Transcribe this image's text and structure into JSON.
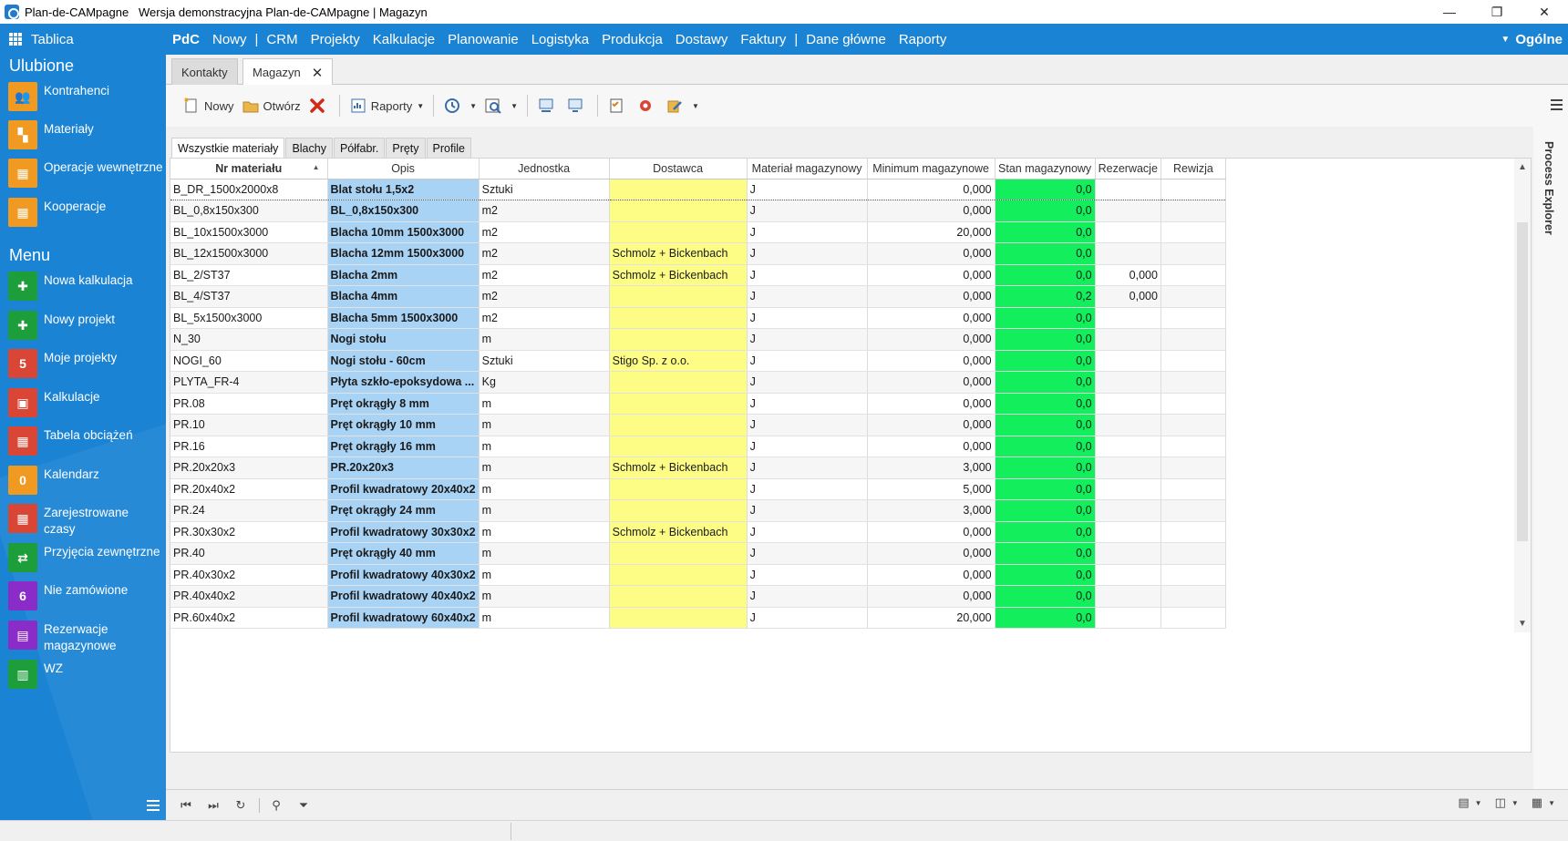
{
  "window": {
    "title": "Plan-de-CAMpagne   Wersja demonstracyjna Plan-de-CAMpagne | Magazyn",
    "minimize": "—",
    "restore": "❐",
    "close": "✕"
  },
  "menubar": {
    "home": "Tablica",
    "items": [
      "PdC",
      "Nowy",
      "|",
      "CRM",
      "Projekty",
      "Kalkulacje",
      "Planowanie",
      "Logistyka",
      "Produkcja",
      "Dostawy",
      "Faktury",
      "|",
      "Dane główne",
      "Raporty"
    ],
    "right": "Ogólne"
  },
  "sidebar": {
    "favorites_heading": "Ulubione",
    "favorites": [
      {
        "label": "Kontrahenci",
        "icon": "people-icon",
        "color": "#f09a22"
      },
      {
        "label": "Materiały",
        "icon": "materials-icon",
        "color": "#f09a22"
      },
      {
        "label": "Operacje wewnętrzne",
        "icon": "table-icon",
        "color": "#f09a22"
      },
      {
        "label": "Kooperacje",
        "icon": "table-icon",
        "color": "#f09a22"
      }
    ],
    "menu_heading": "Menu",
    "menu": [
      {
        "label": "Nowa kalkulacja",
        "icon": "new-document-icon",
        "color": "#1e9e3a",
        "badge": ""
      },
      {
        "label": "Nowy projekt",
        "icon": "new-document-icon",
        "color": "#1e9e3a",
        "badge": ""
      },
      {
        "label": "Moje projekty",
        "icon": "count-badge",
        "color": "#d94636",
        "badge": "5"
      },
      {
        "label": "Kalkulacje",
        "icon": "calculator-icon",
        "color": "#d94636",
        "badge": ""
      },
      {
        "label": "Tabela obciążeń",
        "icon": "table-icon",
        "color": "#d94636",
        "badge": ""
      },
      {
        "label": "Kalendarz",
        "icon": "count-badge",
        "color": "#f09a22",
        "badge": "0"
      },
      {
        "label": "Zarejestrowane czasy",
        "icon": "table-icon",
        "color": "#d94636",
        "badge": ""
      },
      {
        "label": "Przyjęcia zewnętrzne",
        "icon": "receipt-icon",
        "color": "#1e9e3a",
        "badge": ""
      },
      {
        "label": "Nie zamówione",
        "icon": "count-badge",
        "color": "#8a2cc8",
        "badge": "6"
      },
      {
        "label": "Rezerwacje magazynowe",
        "icon": "reservation-icon",
        "color": "#8a2cc8",
        "badge": ""
      },
      {
        "label": "WZ",
        "icon": "document-icon",
        "color": "#1e9e3a",
        "badge": ""
      }
    ]
  },
  "doctabs": {
    "tabs": [
      {
        "label": "Kontakty",
        "active": false
      },
      {
        "label": "Magazyn",
        "active": true
      }
    ],
    "close": "✕"
  },
  "toolbar": {
    "new_label": "Nowy",
    "open_label": "Otwórz",
    "reports_label": "Raporty"
  },
  "filter_tabs": [
    "Wszystkie materiały",
    "Blachy",
    "Półfabr.",
    "Pręty",
    "Profile"
  ],
  "grid": {
    "columns": [
      "Nr materiału",
      "Opis",
      "Jednostka",
      "Dostawca",
      "Materiał magazynowy",
      "Minimum magazynowe",
      "Stan magazynowy",
      "Rezerwacje",
      "Rewizja"
    ],
    "rows": [
      [
        "B_DR_1500x2000x8",
        "Blat stołu 1,5x2",
        "Sztuki",
        "",
        "J",
        "0,000",
        "0,0",
        "",
        ""
      ],
      [
        "BL_0,8x150x300",
        "BL_0,8x150x300",
        "m2",
        "",
        "J",
        "0,000",
        "0,0",
        "",
        ""
      ],
      [
        "BL_10x1500x3000",
        "Blacha 10mm 1500x3000",
        "m2",
        "",
        "J",
        "20,000",
        "0,0",
        "",
        ""
      ],
      [
        "BL_12x1500x3000",
        "Blacha 12mm 1500x3000",
        "m2",
        "Schmolz + Bickenbach",
        "J",
        "0,000",
        "0,0",
        "",
        ""
      ],
      [
        "BL_2/ST37",
        "Blacha 2mm",
        "m2",
        "Schmolz + Bickenbach",
        "J",
        "0,000",
        "0,0",
        "0,000",
        ""
      ],
      [
        "BL_4/ST37",
        "Blacha 4mm",
        "m2",
        "",
        "J",
        "0,000",
        "0,2",
        "0,000",
        ""
      ],
      [
        "BL_5x1500x3000",
        "Blacha 5mm 1500x3000",
        "m2",
        "",
        "J",
        "0,000",
        "0,0",
        "",
        ""
      ],
      [
        "N_30",
        "Nogi stołu",
        "m",
        "",
        "J",
        "0,000",
        "0,0",
        "",
        ""
      ],
      [
        "NOGI_60",
        "Nogi stołu - 60cm",
        "Sztuki",
        "Stigo Sp. z o.o.",
        "J",
        "0,000",
        "0,0",
        "",
        ""
      ],
      [
        "PLYTA_FR-4",
        "Płyta szkło-epoksydowa ...",
        "Kg",
        "",
        "J",
        "0,000",
        "0,0",
        "",
        ""
      ],
      [
        "PR.08",
        "Pręt okrągły 8 mm",
        "m",
        "",
        "J",
        "0,000",
        "0,0",
        "",
        ""
      ],
      [
        "PR.10",
        "Pręt okrągły 10 mm",
        "m",
        "",
        "J",
        "0,000",
        "0,0",
        "",
        ""
      ],
      [
        "PR.16",
        "Pręt okrągły 16 mm",
        "m",
        "",
        "J",
        "0,000",
        "0,0",
        "",
        ""
      ],
      [
        "PR.20x20x3",
        "PR.20x20x3",
        "m",
        "Schmolz + Bickenbach",
        "J",
        "3,000",
        "0,0",
        "",
        ""
      ],
      [
        "PR.20x40x2",
        "Profil kwadratowy 20x40x2",
        "m",
        "",
        "J",
        "5,000",
        "0,0",
        "",
        ""
      ],
      [
        "PR.24",
        "Pręt okrągły 24 mm",
        "m",
        "",
        "J",
        "3,000",
        "0,0",
        "",
        ""
      ],
      [
        "PR.30x30x2",
        "Profil kwadratowy 30x30x2",
        "m",
        "Schmolz + Bickenbach",
        "J",
        "0,000",
        "0,0",
        "",
        ""
      ],
      [
        "PR.40",
        "Pręt okrągły 40 mm",
        "m",
        "",
        "J",
        "0,000",
        "0,0",
        "",
        ""
      ],
      [
        "PR.40x30x2",
        "Profil kwadratowy 40x30x2",
        "m",
        "",
        "J",
        "0,000",
        "0,0",
        "",
        ""
      ],
      [
        "PR.40x40x2",
        "Profil kwadratowy 40x40x2",
        "m",
        "",
        "J",
        "0,000",
        "0,0",
        "",
        ""
      ],
      [
        "PR.60x40x2",
        "Profil kwadratowy 60x40x2",
        "m",
        "",
        "J",
        "20,000",
        "0,0",
        "",
        ""
      ]
    ]
  },
  "process_explorer": "Process Explorer",
  "colors": {
    "brand_blue": "#1a83d4",
    "desc_column": "#a9d3f5",
    "supplier_column": "#fdfd86",
    "stock_column": "#12ee5c"
  }
}
